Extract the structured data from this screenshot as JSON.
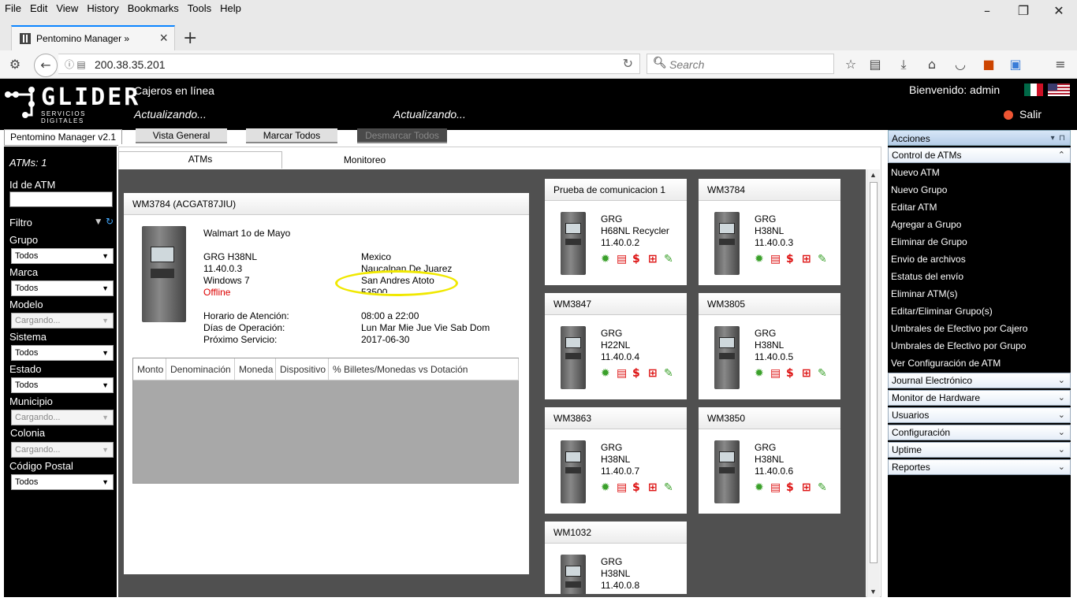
{
  "browser": {
    "menu": [
      "File",
      "Edit",
      "View",
      "History",
      "Bookmarks",
      "Tools",
      "Help"
    ],
    "tab_title": "Pentomino Manager »",
    "url": "200.38.35.201",
    "search_placeholder": "Search"
  },
  "header": {
    "logo_text": "GLIDER",
    "logo_sub": "SERVICIOS DIGITALES",
    "title": "Cajeros en línea",
    "status_left": "Actualizando...",
    "status_right": "Actualizando...",
    "welcome": "Bienvenido: admin",
    "logout": "Salir"
  },
  "toolbar": {
    "app_tab": "Pentomino Manager v2.1",
    "vista_general": "Vista General",
    "marcar_todos": "Marcar Todos",
    "desmarcar_todos": "Desmarcar Todos"
  },
  "filters": {
    "atm_count": "ATMs: 1",
    "id_label": "Id de ATM",
    "filtro_label": "Filtro",
    "fields": [
      {
        "label": "Grupo",
        "value": "Todos",
        "disabled": false
      },
      {
        "label": "Marca",
        "value": "Todos",
        "disabled": false
      },
      {
        "label": "Modelo",
        "value": "Cargando...",
        "disabled": true
      },
      {
        "label": "Sistema",
        "value": "Todos",
        "disabled": false
      },
      {
        "label": "Estado",
        "value": "Todos",
        "disabled": false
      },
      {
        "label": "Municipio",
        "value": "Cargando...",
        "disabled": true
      },
      {
        "label": "Colonia",
        "value": "Cargando...",
        "disabled": true
      },
      {
        "label": "Código Postal",
        "value": "Todos",
        "disabled": false
      }
    ]
  },
  "main_tabs": {
    "atms": "ATMs",
    "monitoreo": "Monitoreo"
  },
  "detail": {
    "title": "WM3784 (ACGAT87JIU)",
    "location_name": "Walmart 1o de Mayo",
    "model": "GRG H38NL",
    "version": "11.40.0.3",
    "os": "Windows 7",
    "status": "Offline",
    "country": "Mexico",
    "city": "Naucalpan De Juarez",
    "colonia": "San Andres Atoto",
    "postal": "53500",
    "hours_label": "Horario de Atención:",
    "hours_value": "08:00 a 22:00",
    "days_label": "Días de Operación:",
    "days_value": "Lun Mar Mie Jue Vie Sab Dom",
    "next_label": "Próximo Servicio:",
    "next_value": "2017-06-30",
    "table_headers": [
      "Monto",
      "Denominación",
      "Moneda",
      "Dispositivo",
      "% Billetes/Monedas vs Dotación"
    ]
  },
  "atm_cards": [
    {
      "name": "Prueba de comunicacion 1",
      "brand": "GRG",
      "model": "H68NL Recycler",
      "version": "11.40.0.2"
    },
    {
      "name": "WM3784",
      "brand": "GRG",
      "model": "H38NL",
      "version": "11.40.0.3"
    },
    {
      "name": "WM3847",
      "brand": "GRG",
      "model": "H22NL",
      "version": "11.40.0.4"
    },
    {
      "name": "WM3805",
      "brand": "GRG",
      "model": "H38NL",
      "version": "11.40.0.5"
    },
    {
      "name": "WM3863",
      "brand": "GRG",
      "model": "H38NL",
      "version": "11.40.0.7"
    },
    {
      "name": "WM3850",
      "brand": "GRG",
      "model": "H38NL",
      "version": "11.40.0.6"
    },
    {
      "name": "WM1032",
      "brand": "GRG",
      "model": "H38NL",
      "version": "11.40.0.8"
    }
  ],
  "card_icons": [
    "gear-icon",
    "document-icon",
    "dollar-icon",
    "network-icon",
    "wrench-icon"
  ],
  "sidebar": {
    "title": "Acciones",
    "groups": [
      {
        "label": "Control de ATMs",
        "items": [
          "Nuevo ATM",
          "Nuevo Grupo",
          "Editar ATM",
          "Agregar a Grupo",
          "Eliminar de Grupo",
          "Envio de archivos",
          "Estatus del envío",
          "Eliminar ATM(s)",
          "Editar/Eliminar Grupo(s)",
          "Umbrales de Efectivo por Cajero",
          "Umbrales de Efectivo por Grupo",
          "Ver Configuración de ATM"
        ]
      },
      {
        "label": "Journal Electrónico"
      },
      {
        "label": "Monitor de Hardware"
      },
      {
        "label": "Usuarios"
      },
      {
        "label": "Configuración"
      },
      {
        "label": "Uptime"
      },
      {
        "label": "Reportes"
      }
    ]
  },
  "colors": {
    "accent": "#0a84ff",
    "offline": "#dd0000",
    "highlight": "#f0e800",
    "icon_green": "#3aa02a",
    "icon_red": "#d11111"
  }
}
